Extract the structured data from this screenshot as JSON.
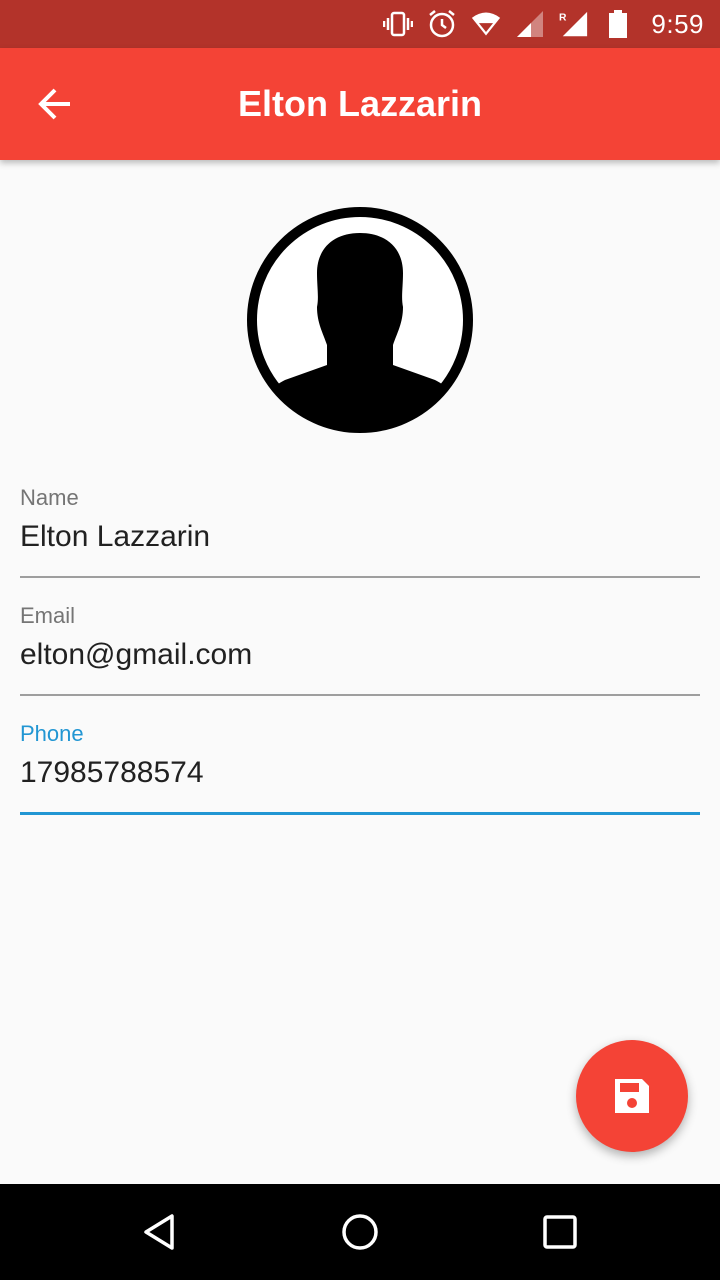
{
  "status_bar": {
    "time": "9:59",
    "icons": [
      "vibrate-icon",
      "alarm-icon",
      "wifi-icon",
      "signal-icon",
      "roaming-signal-icon",
      "battery-icon"
    ],
    "color": "#b3332a"
  },
  "app_bar": {
    "title": "Elton Lazzarin",
    "back_icon": "arrow-back-icon",
    "color": "#f44336"
  },
  "avatar": {
    "icon": "person-silhouette-icon"
  },
  "form": {
    "name": {
      "label": "Name",
      "value": "Elton Lazzarin"
    },
    "email": {
      "label": "Email",
      "value": "elton@gmail.com"
    },
    "phone": {
      "label": "Phone",
      "value": "17985788574",
      "focused": true
    }
  },
  "accent_color": "#2196d3",
  "fab": {
    "icon": "save-icon",
    "color": "#f44336"
  },
  "nav_bar": {
    "icons": [
      "nav-back-icon",
      "nav-home-icon",
      "nav-recents-icon"
    ]
  }
}
